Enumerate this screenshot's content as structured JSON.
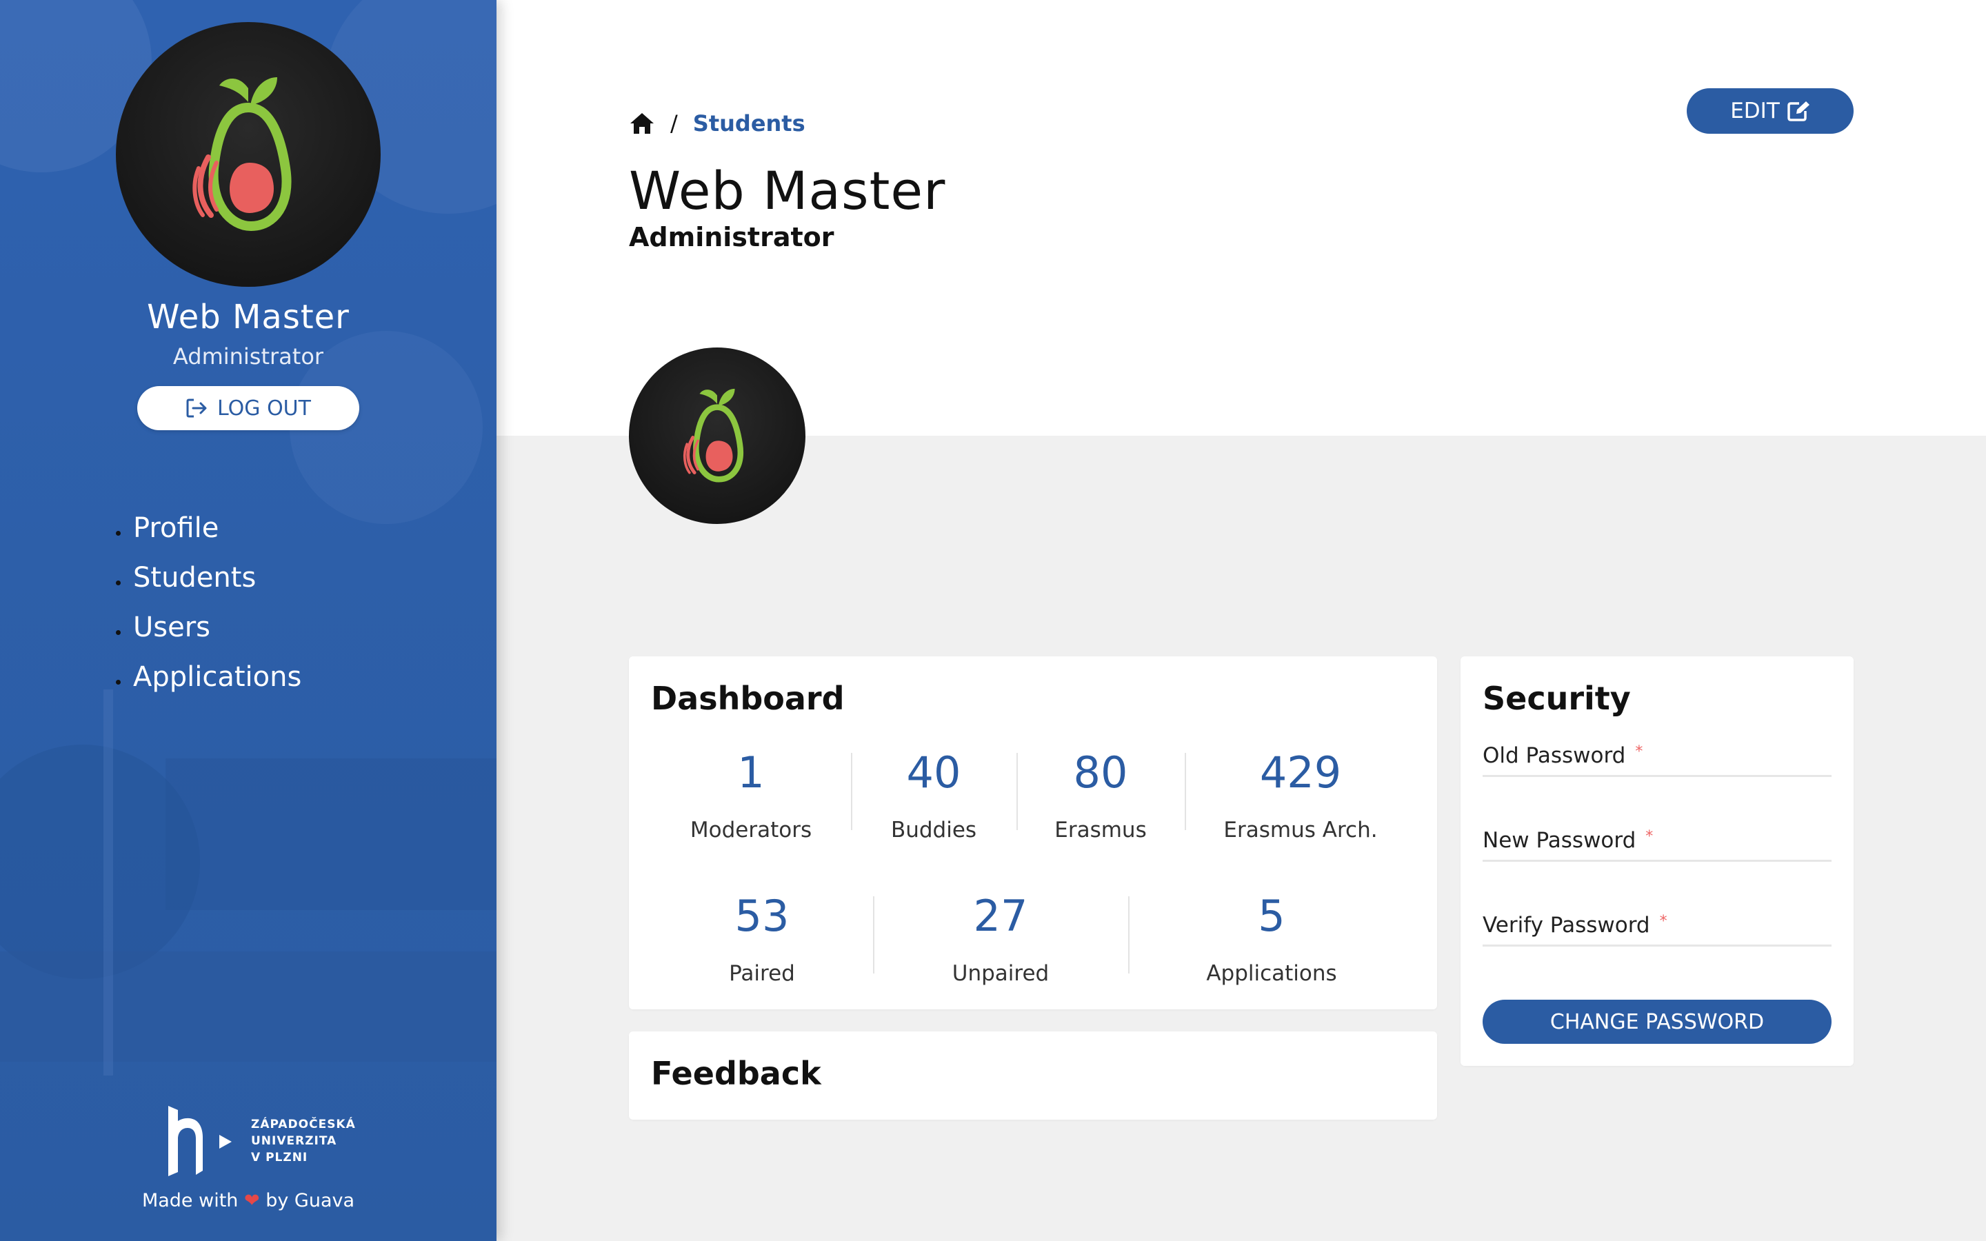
{
  "sidebar": {
    "user_name": "Web Master",
    "user_role": "Administrator",
    "logout_label": "LOG OUT",
    "nav": [
      "Profile",
      "Students",
      "Users",
      "Applications"
    ],
    "university_logo_text": [
      "ZÁPADOČESKÁ",
      "UNIVERZITA",
      "V PLZNI"
    ],
    "footer_made_with": "Made with",
    "footer_by": "by Guava"
  },
  "header": {
    "breadcrumb_home_icon": "home-icon",
    "breadcrumb_separator": "/",
    "breadcrumb_current": "Students",
    "title": "Web Master",
    "subtitle": "Administrator",
    "edit_label": "EDIT"
  },
  "dashboard": {
    "title": "Dashboard",
    "row1": [
      {
        "value": "1",
        "label": "Moderators"
      },
      {
        "value": "40",
        "label": "Buddies"
      },
      {
        "value": "80",
        "label": "Erasmus"
      },
      {
        "value": "429",
        "label": "Erasmus Arch."
      }
    ],
    "row2": [
      {
        "value": "53",
        "label": "Paired"
      },
      {
        "value": "27",
        "label": "Unpaired"
      },
      {
        "value": "5",
        "label": "Applications"
      }
    ]
  },
  "feedback": {
    "title": "Feedback"
  },
  "security": {
    "title": "Security",
    "old_password_label": "Old Password",
    "new_password_label": "New Password",
    "verify_password_label": "Verify Password",
    "required_marker": "*",
    "change_password_label": "CHANGE PASSWORD"
  },
  "colors": {
    "primary": "#2b5ca3",
    "sidebar_bg": "#2f62b0",
    "avatar_bg": "#1a1a1a",
    "logo_green": "#8cc63f",
    "logo_coral": "#e8605e",
    "required": "#e66666"
  }
}
